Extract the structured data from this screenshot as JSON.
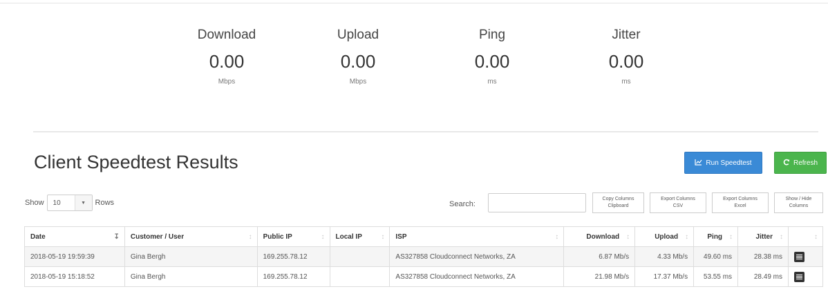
{
  "metrics": [
    {
      "label": "Download",
      "value": "0.00",
      "unit": "Mbps"
    },
    {
      "label": "Upload",
      "value": "0.00",
      "unit": "Mbps"
    },
    {
      "label": "Ping",
      "value": "0.00",
      "unit": "ms"
    },
    {
      "label": "Jitter",
      "value": "0.00",
      "unit": "ms"
    }
  ],
  "page": {
    "title": "Client Speedtest Results"
  },
  "actions": {
    "run": "Run Speedtest",
    "refresh": "Refresh"
  },
  "length": {
    "prefix": "Show",
    "value": "10",
    "suffix": "Rows"
  },
  "search": {
    "label": "Search:",
    "value": ""
  },
  "table_buttons": [
    {
      "line1": "Copy Columns",
      "line2": "Clipboard"
    },
    {
      "line1": "Export Columns",
      "line2": "CSV"
    },
    {
      "line1": "Export Columns",
      "line2": "Excel"
    },
    {
      "line1": "Show / Hide",
      "line2": "Columns"
    }
  ],
  "table": {
    "headers": [
      "Date",
      "Customer / User",
      "Public IP",
      "Local IP",
      "ISP",
      "Download",
      "Upload",
      "Ping",
      "Jitter",
      ""
    ],
    "rows": [
      [
        "2018-05-19 19:59:39",
        "Gina Bergh",
        "169.255.78.12",
        "",
        "AS327858 Cloudconnect Networks, ZA",
        "6.87 Mb/s",
        "4.33 Mb/s",
        "49.60 ms",
        "28.38 ms"
      ],
      [
        "2018-05-19 15:18:52",
        "Gina Bergh",
        "169.255.78.12",
        "",
        "AS327858 Cloudconnect Networks, ZA",
        "21.98 Mb/s",
        "17.37 Mb/s",
        "53.55 ms",
        "28.49 ms"
      ]
    ]
  },
  "colors": {
    "primary": "#3a8ad6",
    "success": "#4bb54d"
  },
  "icons": {
    "run": "chart-line-icon",
    "refresh": "refresh-icon",
    "row": "calendar-icon"
  }
}
